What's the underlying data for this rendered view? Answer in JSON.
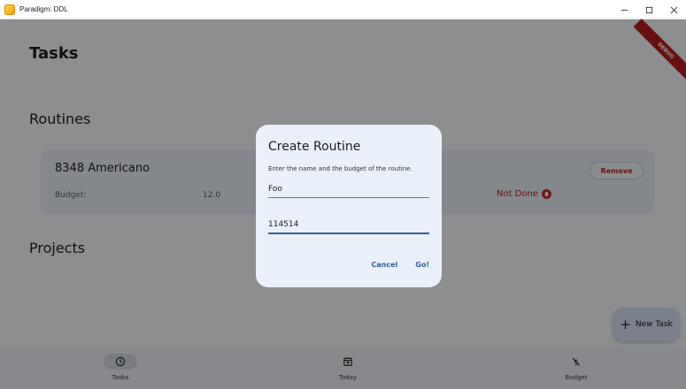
{
  "window": {
    "title": "Paradigm: DDL"
  },
  "header": {
    "title": "Tasks"
  },
  "sections": {
    "routines": "Routines",
    "projects": "Projects"
  },
  "routine": {
    "name": "8348 Americano",
    "budget_label": "Budget:",
    "budget_value": "12.0",
    "remove_label": "Remove",
    "status": "Not Done"
  },
  "fab": {
    "label": "New Task"
  },
  "nav": {
    "items": [
      {
        "label": "Tasks"
      },
      {
        "label": "Today"
      },
      {
        "label": "Budget"
      }
    ]
  },
  "debug_banner": "DEBUG",
  "dialog": {
    "title": "Create Routine",
    "description": "Enter the name and the budget of the routine.",
    "name_value": "Foo",
    "budget_value": "114514",
    "cancel_label": "Cancel",
    "confirm_label": "Go!"
  },
  "colors": {
    "accent": "#2f5f9a",
    "danger": "#b3261e",
    "debug": "#b71c1c"
  },
  "icons": {
    "nav_tasks": "clock-icon",
    "nav_today": "calendar-icon",
    "nav_budget": "money-off-icon",
    "status": "alert-icon",
    "fab": "plus-icon"
  }
}
